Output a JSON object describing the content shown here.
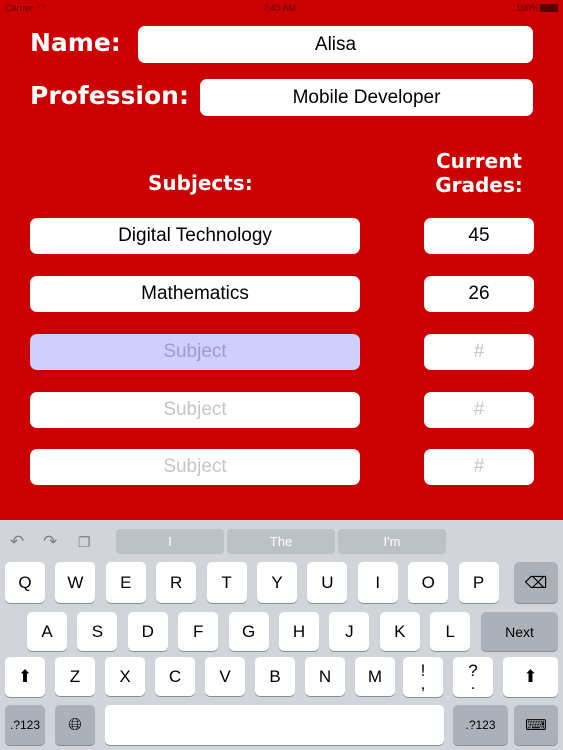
{
  "status": {
    "carrier": "Carrier",
    "time": "7:43 AM",
    "battery": "100%"
  },
  "form": {
    "name_label": "Name:",
    "name_value": "Alisa",
    "profession_label": "Profession:",
    "profession_value": "Mobile Developer",
    "subjects_header": "Subjects:",
    "grades_header_1": "Current",
    "grades_header_2": "Grades:",
    "rows": [
      {
        "subject": "Digital Technology",
        "grade": "45"
      },
      {
        "subject": "Mathematics",
        "grade": "26"
      },
      {
        "subject_placeholder": "Subject",
        "grade_placeholder": "#"
      },
      {
        "subject_placeholder": "Subject",
        "grade_placeholder": "#"
      },
      {
        "subject_placeholder": "Subject",
        "grade_placeholder": "#"
      }
    ]
  },
  "keyboard": {
    "suggestions": [
      "I",
      "The",
      "I'm"
    ],
    "row1": [
      "Q",
      "W",
      "E",
      "R",
      "T",
      "Y",
      "U",
      "I",
      "O",
      "P"
    ],
    "row2": [
      "A",
      "S",
      "D",
      "F",
      "G",
      "H",
      "J",
      "K",
      "L"
    ],
    "row3": [
      "Z",
      "X",
      "C",
      "V",
      "B",
      "N",
      "M"
    ],
    "exclam": "!",
    "comma": ",",
    "question": "?",
    "period": ".",
    "next": "Next",
    "numbers": ".?123"
  },
  "colors": {
    "background": "#cc0000",
    "active_field": "#cfcffd"
  }
}
